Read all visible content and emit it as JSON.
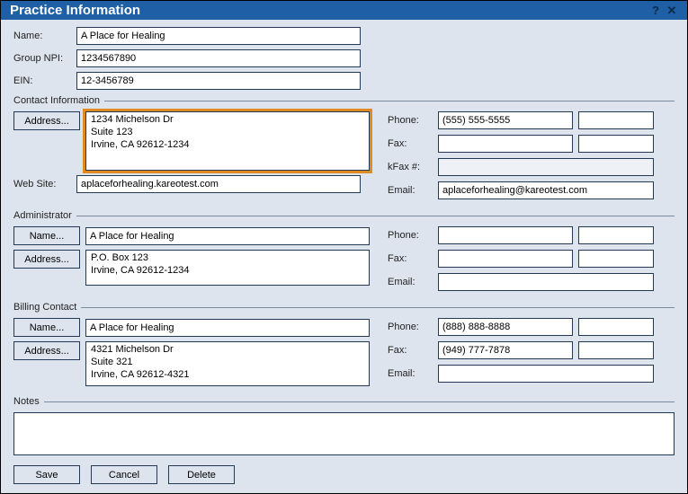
{
  "window": {
    "title": "Practice Information"
  },
  "basic": {
    "name_label": "Name:",
    "name": "A Place for Healing",
    "groupnpi_label": "Group NPI:",
    "groupnpi": "1234567890",
    "ein_label": "EIN:",
    "ein": "12-3456789"
  },
  "contact": {
    "legend": "Contact Information",
    "address_btn": "Address...",
    "address_line1": "1234 Michelson Dr",
    "address_line2": "Suite 123",
    "address_line3": "Irvine, CA 92612-1234",
    "website_label": "Web Site:",
    "website": "aplaceforhealing.kareotest.com",
    "phone_label": "Phone:",
    "phone": "(555) 555-5555",
    "phone_ext": "",
    "fax_label": "Fax:",
    "fax": "",
    "fax_ext": "",
    "kfax_label": "kFax #:",
    "kfax": "",
    "email_label": "Email:",
    "email": "aplaceforhealing@kareotest.com"
  },
  "admin": {
    "legend": "Administrator",
    "name_btn": "Name...",
    "name": "A Place for Healing",
    "address_btn": "Address...",
    "address_line1": "P.O. Box 123",
    "address_line2": "Irvine, CA 92612-1234",
    "phone_label": "Phone:",
    "phone": "",
    "phone_ext": "",
    "fax_label": "Fax:",
    "fax": "",
    "fax_ext": "",
    "email_label": "Email:",
    "email": ""
  },
  "billing": {
    "legend": "Billing Contact",
    "name_btn": "Name...",
    "name": "A Place for Healing",
    "address_btn": "Address...",
    "address_line1": "4321 Michelson Dr",
    "address_line2": "Suite 321",
    "address_line3": "Irvine, CA 92612-4321",
    "phone_label": "Phone:",
    "phone": "(888) 888-8888",
    "phone_ext": "",
    "fax_label": "Fax:",
    "fax": "(949) 777-7878",
    "fax_ext": "",
    "email_label": "Email:",
    "email": ""
  },
  "notes": {
    "legend": "Notes",
    "value": ""
  },
  "buttons": {
    "save": "Save",
    "cancel": "Cancel",
    "delete": "Delete"
  }
}
